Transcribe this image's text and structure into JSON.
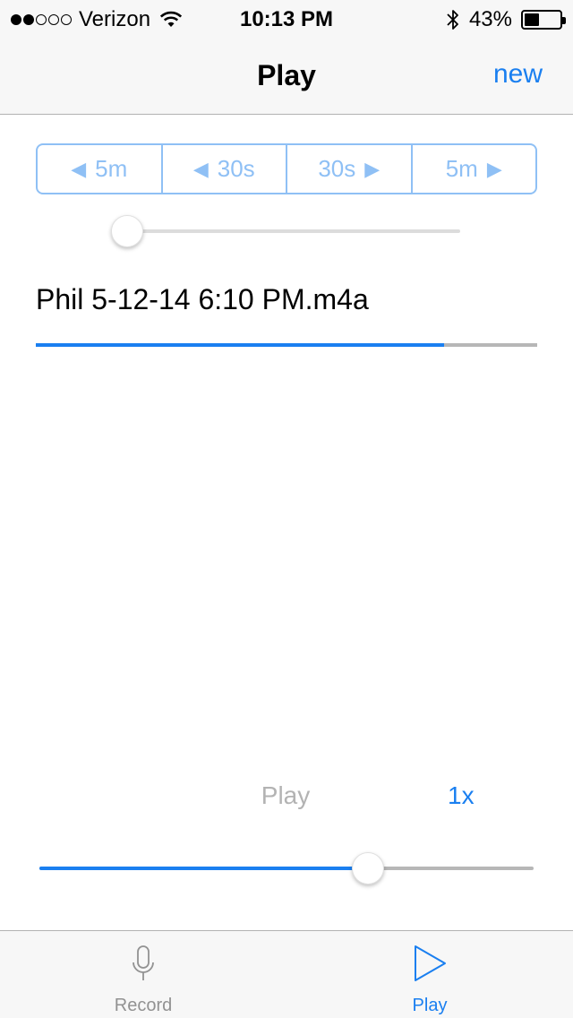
{
  "status_bar": {
    "signal_bars_full": 2,
    "signal_bars_total": 5,
    "carrier": "Verizon",
    "time": "10:13 PM",
    "battery_text": "43%",
    "battery_level": 0.43
  },
  "nav": {
    "title": "Play",
    "new_label": "new"
  },
  "skip_buttons": [
    {
      "label": "5m",
      "direction": "back"
    },
    {
      "label": "30s",
      "direction": "back"
    },
    {
      "label": "30s",
      "direction": "forward"
    },
    {
      "label": "5m",
      "direction": "forward"
    }
  ],
  "position_slider": {
    "value": 0.0
  },
  "file": {
    "name": "Phil 5-12-14 6:10 PM.m4a",
    "progress": 0.815
  },
  "controls": {
    "play_label": "Play",
    "rate_label": "1x"
  },
  "speed_slider": {
    "value": 0.664
  },
  "tabs": [
    {
      "label": "Record",
      "icon": "microphone-icon",
      "active": false
    },
    {
      "label": "Play",
      "icon": "play-icon",
      "active": true
    }
  ],
  "colors": {
    "accent": "#1a7ff0",
    "accent_light": "#8fc0f5",
    "disabled": "#b3b3b3"
  }
}
